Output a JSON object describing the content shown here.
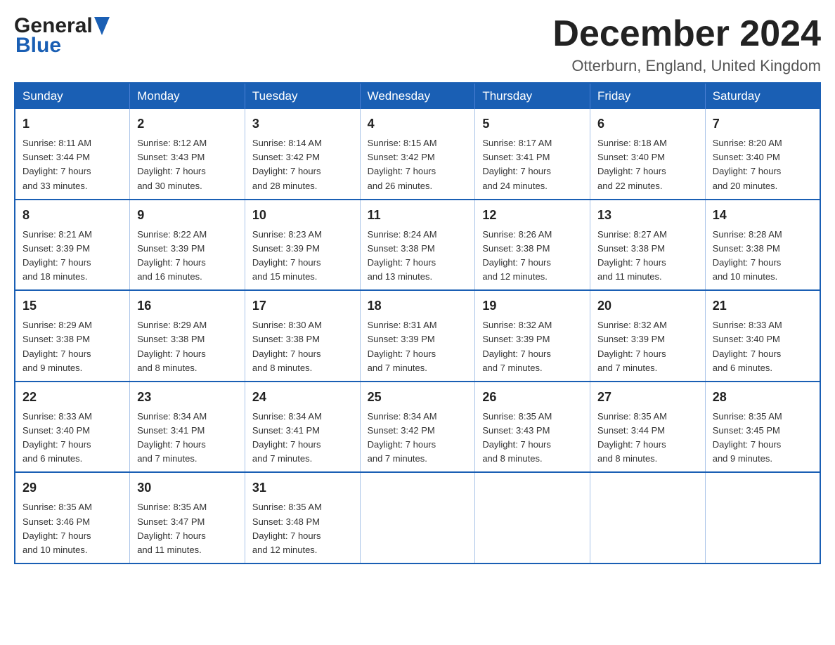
{
  "header": {
    "month_title": "December 2024",
    "location": "Otterburn, England, United Kingdom",
    "logo_general": "General",
    "logo_blue": "Blue"
  },
  "weekdays": [
    "Sunday",
    "Monday",
    "Tuesday",
    "Wednesday",
    "Thursday",
    "Friday",
    "Saturday"
  ],
  "weeks": [
    [
      {
        "day": 1,
        "info": "Sunrise: 8:11 AM\nSunset: 3:44 PM\nDaylight: 7 hours\nand 33 minutes."
      },
      {
        "day": 2,
        "info": "Sunrise: 8:12 AM\nSunset: 3:43 PM\nDaylight: 7 hours\nand 30 minutes."
      },
      {
        "day": 3,
        "info": "Sunrise: 8:14 AM\nSunset: 3:42 PM\nDaylight: 7 hours\nand 28 minutes."
      },
      {
        "day": 4,
        "info": "Sunrise: 8:15 AM\nSunset: 3:42 PM\nDaylight: 7 hours\nand 26 minutes."
      },
      {
        "day": 5,
        "info": "Sunrise: 8:17 AM\nSunset: 3:41 PM\nDaylight: 7 hours\nand 24 minutes."
      },
      {
        "day": 6,
        "info": "Sunrise: 8:18 AM\nSunset: 3:40 PM\nDaylight: 7 hours\nand 22 minutes."
      },
      {
        "day": 7,
        "info": "Sunrise: 8:20 AM\nSunset: 3:40 PM\nDaylight: 7 hours\nand 20 minutes."
      }
    ],
    [
      {
        "day": 8,
        "info": "Sunrise: 8:21 AM\nSunset: 3:39 PM\nDaylight: 7 hours\nand 18 minutes."
      },
      {
        "day": 9,
        "info": "Sunrise: 8:22 AM\nSunset: 3:39 PM\nDaylight: 7 hours\nand 16 minutes."
      },
      {
        "day": 10,
        "info": "Sunrise: 8:23 AM\nSunset: 3:39 PM\nDaylight: 7 hours\nand 15 minutes."
      },
      {
        "day": 11,
        "info": "Sunrise: 8:24 AM\nSunset: 3:38 PM\nDaylight: 7 hours\nand 13 minutes."
      },
      {
        "day": 12,
        "info": "Sunrise: 8:26 AM\nSunset: 3:38 PM\nDaylight: 7 hours\nand 12 minutes."
      },
      {
        "day": 13,
        "info": "Sunrise: 8:27 AM\nSunset: 3:38 PM\nDaylight: 7 hours\nand 11 minutes."
      },
      {
        "day": 14,
        "info": "Sunrise: 8:28 AM\nSunset: 3:38 PM\nDaylight: 7 hours\nand 10 minutes."
      }
    ],
    [
      {
        "day": 15,
        "info": "Sunrise: 8:29 AM\nSunset: 3:38 PM\nDaylight: 7 hours\nand 9 minutes."
      },
      {
        "day": 16,
        "info": "Sunrise: 8:29 AM\nSunset: 3:38 PM\nDaylight: 7 hours\nand 8 minutes."
      },
      {
        "day": 17,
        "info": "Sunrise: 8:30 AM\nSunset: 3:38 PM\nDaylight: 7 hours\nand 8 minutes."
      },
      {
        "day": 18,
        "info": "Sunrise: 8:31 AM\nSunset: 3:39 PM\nDaylight: 7 hours\nand 7 minutes."
      },
      {
        "day": 19,
        "info": "Sunrise: 8:32 AM\nSunset: 3:39 PM\nDaylight: 7 hours\nand 7 minutes."
      },
      {
        "day": 20,
        "info": "Sunrise: 8:32 AM\nSunset: 3:39 PM\nDaylight: 7 hours\nand 7 minutes."
      },
      {
        "day": 21,
        "info": "Sunrise: 8:33 AM\nSunset: 3:40 PM\nDaylight: 7 hours\nand 6 minutes."
      }
    ],
    [
      {
        "day": 22,
        "info": "Sunrise: 8:33 AM\nSunset: 3:40 PM\nDaylight: 7 hours\nand 6 minutes."
      },
      {
        "day": 23,
        "info": "Sunrise: 8:34 AM\nSunset: 3:41 PM\nDaylight: 7 hours\nand 7 minutes."
      },
      {
        "day": 24,
        "info": "Sunrise: 8:34 AM\nSunset: 3:41 PM\nDaylight: 7 hours\nand 7 minutes."
      },
      {
        "day": 25,
        "info": "Sunrise: 8:34 AM\nSunset: 3:42 PM\nDaylight: 7 hours\nand 7 minutes."
      },
      {
        "day": 26,
        "info": "Sunrise: 8:35 AM\nSunset: 3:43 PM\nDaylight: 7 hours\nand 8 minutes."
      },
      {
        "day": 27,
        "info": "Sunrise: 8:35 AM\nSunset: 3:44 PM\nDaylight: 7 hours\nand 8 minutes."
      },
      {
        "day": 28,
        "info": "Sunrise: 8:35 AM\nSunset: 3:45 PM\nDaylight: 7 hours\nand 9 minutes."
      }
    ],
    [
      {
        "day": 29,
        "info": "Sunrise: 8:35 AM\nSunset: 3:46 PM\nDaylight: 7 hours\nand 10 minutes."
      },
      {
        "day": 30,
        "info": "Sunrise: 8:35 AM\nSunset: 3:47 PM\nDaylight: 7 hours\nand 11 minutes."
      },
      {
        "day": 31,
        "info": "Sunrise: 8:35 AM\nSunset: 3:48 PM\nDaylight: 7 hours\nand 12 minutes."
      },
      {
        "day": null,
        "info": ""
      },
      {
        "day": null,
        "info": ""
      },
      {
        "day": null,
        "info": ""
      },
      {
        "day": null,
        "info": ""
      }
    ]
  ]
}
